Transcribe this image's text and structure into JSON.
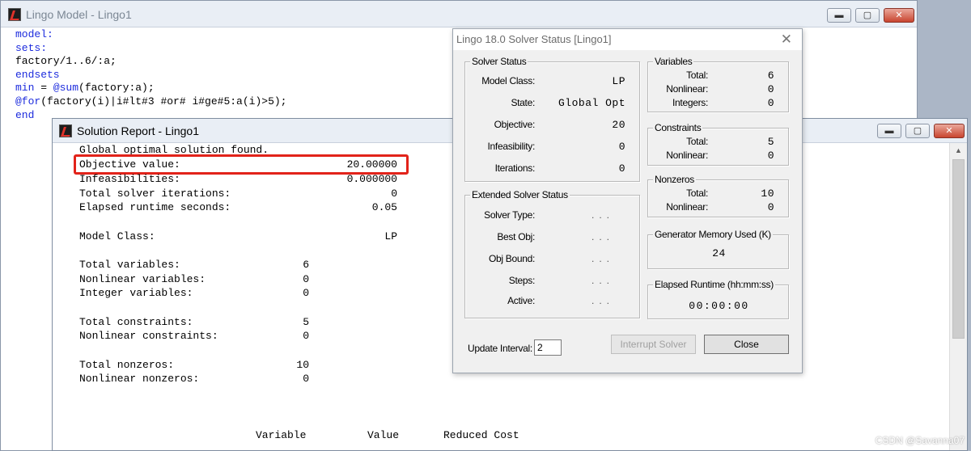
{
  "model_window": {
    "title": "Lingo Model - Lingo1",
    "code_lines": [
      [
        {
          "t": "model:",
          "k": true
        }
      ],
      [
        {
          "t": "sets:",
          "k": true
        }
      ],
      [
        {
          "t": "factory/1..6/:a;",
          "k": false
        }
      ],
      [
        {
          "t": "endsets",
          "k": true
        }
      ],
      [
        {
          "t": "min",
          "k": true
        },
        {
          "t": " = ",
          "k": false
        },
        {
          "t": "@sum",
          "k": true
        },
        {
          "t": "(factory:a);",
          "k": false
        }
      ],
      [
        {
          "t": "@for",
          "k": true
        },
        {
          "t": "(factory(i)|i#lt#3 #or# i#ge#5:a(i)>5);",
          "k": false
        }
      ],
      [
        {
          "t": "end",
          "k": true
        }
      ]
    ],
    "buttons": {
      "minimize": "▬",
      "maximize": "▢",
      "close": "✕"
    }
  },
  "report_window": {
    "title": "Solution Report - Lingo1",
    "buttons": {
      "minimize": "▬",
      "maximize": "▢",
      "close": "✕"
    },
    "header_line": "Global optimal solution found.",
    "summary": [
      {
        "label": "Objective value:",
        "value": "20.00000"
      },
      {
        "label": "Infeasibilities:",
        "value": "0.000000"
      },
      {
        "label": "Total solver iterations:",
        "value": "0"
      },
      {
        "label": "Elapsed runtime seconds:",
        "value": "0.05"
      }
    ],
    "model_class": {
      "label": "Model Class:",
      "value": "LP"
    },
    "counts": [
      {
        "label": "Total variables:",
        "value": "6"
      },
      {
        "label": "Nonlinear variables:",
        "value": "0"
      },
      {
        "label": "Integer variables:",
        "value": "0"
      },
      {
        "label": "Total constraints:",
        "value": "5"
      },
      {
        "label": "Nonlinear constraints:",
        "value": "0"
      },
      {
        "label": "Total nonzeros:",
        "value": "10"
      },
      {
        "label": "Nonlinear nonzeros:",
        "value": "0"
      }
    ],
    "table_headers": {
      "variable": "Variable",
      "value": "Value",
      "reduced_cost": "Reduced Cost"
    }
  },
  "solver_dialog": {
    "title": "Lingo 18.0 Solver Status [Lingo1]",
    "close_glyph": "✕",
    "solver_status": {
      "label": "Solver Status",
      "model_class": {
        "label": "Model Class:",
        "value": "LP"
      },
      "state": {
        "label": "State:",
        "value": "Global Opt"
      },
      "objective": {
        "label": "Objective:",
        "value": "20"
      },
      "infeasibility": {
        "label": "Infeasibility:",
        "value": "0"
      },
      "iterations": {
        "label": "Iterations:",
        "value": "0"
      }
    },
    "extended_status": {
      "label": "Extended Solver Status",
      "rows": [
        {
          "label": "Solver Type:",
          "value": "..."
        },
        {
          "label": "Best Obj:",
          "value": "..."
        },
        {
          "label": "Obj Bound:",
          "value": "..."
        },
        {
          "label": "Steps:",
          "value": "..."
        },
        {
          "label": "Active:",
          "value": "..."
        }
      ]
    },
    "variables": {
      "label": "Variables",
      "total": {
        "label": "Total:",
        "value": "6"
      },
      "nonlinear": {
        "label": "Nonlinear:",
        "value": "0"
      },
      "integers": {
        "label": "Integers:",
        "value": "0"
      }
    },
    "constraints": {
      "label": "Constraints",
      "total": {
        "label": "Total:",
        "value": "5"
      },
      "nonlinear": {
        "label": "Nonlinear:",
        "value": "0"
      }
    },
    "nonzeros": {
      "label": "Nonzeros",
      "total": {
        "label": "Total:",
        "value": "10"
      },
      "nonlinear": {
        "label": "Nonlinear:",
        "value": "0"
      }
    },
    "generator_memory": {
      "label": "Generator Memory Used (K)",
      "value": "24"
    },
    "elapsed_runtime": {
      "label": "Elapsed Runtime (hh:mm:ss)",
      "value": "00:00:00"
    },
    "update_interval": {
      "label": "Update Interval:",
      "value": "2"
    },
    "interrupt_button": "Interrupt Solver",
    "close_button": "Close"
  },
  "watermark": "CSDN @Savanna07",
  "colors": {
    "keyword": "#1c2bdd",
    "highlight": "#e2231a"
  }
}
